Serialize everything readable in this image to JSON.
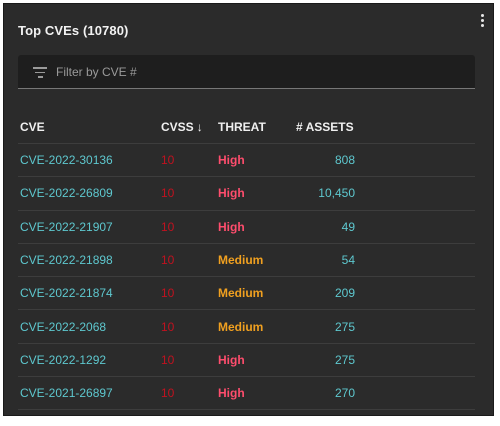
{
  "card": {
    "title": "Top CVEs (10780)",
    "menu_icon": "kebab-vertical-icon"
  },
  "filter": {
    "icon": "filter-list-icon",
    "placeholder": "Filter by CVE #",
    "value": ""
  },
  "table": {
    "headers": {
      "cve": "CVE",
      "cvss": "CVSS",
      "cvss_sort": "↓",
      "threat": "THREAT",
      "assets": "# ASSETS"
    },
    "rows": [
      {
        "cve": "CVE-2022-30136",
        "cvss": "10",
        "threat": "High",
        "assets": "808"
      },
      {
        "cve": "CVE-2022-26809",
        "cvss": "10",
        "threat": "High",
        "assets": "10,450"
      },
      {
        "cve": "CVE-2022-21907",
        "cvss": "10",
        "threat": "High",
        "assets": "49"
      },
      {
        "cve": "CVE-2022-21898",
        "cvss": "10",
        "threat": "Medium",
        "assets": "54"
      },
      {
        "cve": "CVE-2022-21874",
        "cvss": "10",
        "threat": "Medium",
        "assets": "209"
      },
      {
        "cve": "CVE-2022-2068",
        "cvss": "10",
        "threat": "Medium",
        "assets": "275"
      },
      {
        "cve": "CVE-2022-1292",
        "cvss": "10",
        "threat": "High",
        "assets": "275"
      },
      {
        "cve": "CVE-2021-26897",
        "cvss": "10",
        "threat": "High",
        "assets": "270"
      }
    ]
  },
  "colors": {
    "card_bg": "#2b2b2b",
    "link": "#5ec8cf",
    "cvss": "#c1121f",
    "threat_high": "#ff4d6d",
    "threat_medium": "#f0a020"
  }
}
